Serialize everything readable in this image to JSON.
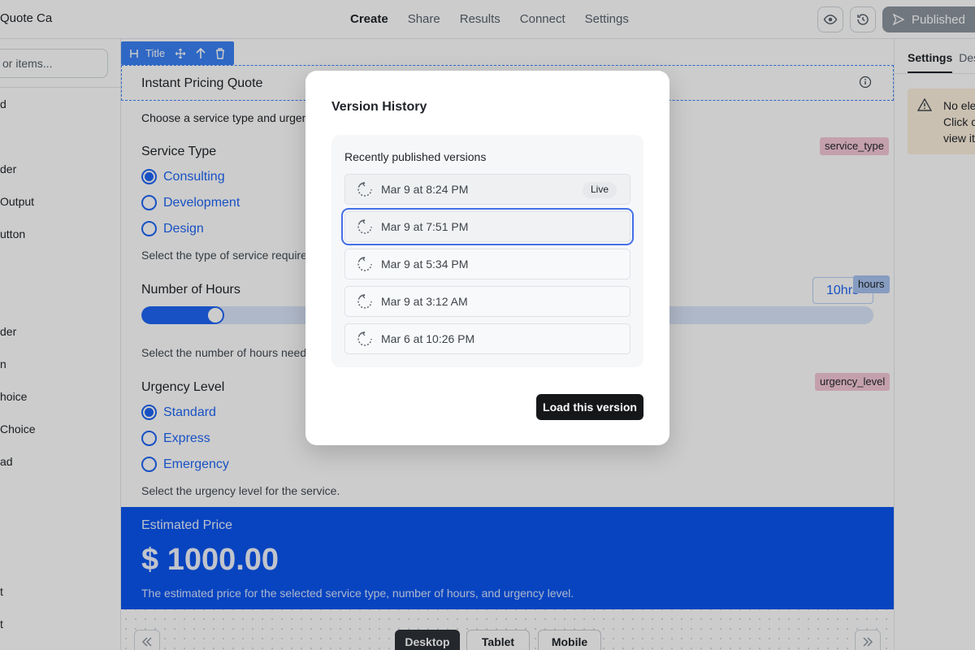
{
  "app": {
    "name": "Quote Ca"
  },
  "nav": {
    "tabs": [
      {
        "label": "Create",
        "active": true
      },
      {
        "label": "Share"
      },
      {
        "label": "Results"
      },
      {
        "label": "Connect"
      },
      {
        "label": "Settings"
      }
    ]
  },
  "toolbar": {
    "publish_label": "Published",
    "preview_icon": "eye-icon",
    "history_icon": "history-icon"
  },
  "sidebar": {
    "search_placeholder": "or items...",
    "items": [
      {
        "label": "d"
      },
      {
        "label": "der"
      },
      {
        "label": "Output"
      },
      {
        "label": "utton"
      },
      {
        "label": "der"
      },
      {
        "label": "n"
      },
      {
        "label": "hoice"
      },
      {
        "label": "Choice"
      },
      {
        "label": "ad"
      },
      {
        "label": "t"
      },
      {
        "label": "t"
      }
    ]
  },
  "form": {
    "toolbar_label": "Title",
    "title": "Instant Pricing Quote",
    "description": "Choose a service type and urgency",
    "service_type": {
      "label": "Service Type",
      "tag": "service_type",
      "options": [
        "Consulting",
        "Development",
        "Design"
      ],
      "selected": "Consulting",
      "help": "Select the type of service required"
    },
    "hours": {
      "label": "Number of Hours",
      "tag": "hours",
      "value_display": "10hrs",
      "slider_fraction": 0.1,
      "help": "Select the number of hours needed"
    },
    "urgency": {
      "label": "Urgency Level",
      "tag": "urgency_level",
      "options": [
        "Standard",
        "Express",
        "Emergency"
      ],
      "selected": "Standard",
      "help": "Select the urgency level for the service."
    },
    "price": {
      "label": "Estimated Price",
      "value": "$ 1000.00",
      "note": "The estimated price for the selected service type, number of hours, and urgency level."
    }
  },
  "devices": {
    "buttons": [
      "Desktop",
      "Tablet",
      "Mobile"
    ],
    "active": "Desktop"
  },
  "right_panel": {
    "tabs": [
      "Settings",
      "Des"
    ],
    "warning_lines": [
      "No ele",
      "Click c",
      "view it"
    ]
  },
  "modal": {
    "title": "Version History",
    "list_heading": "Recently published versions",
    "versions": [
      {
        "label": "Mar 9 at 8:24 PM",
        "badge": "Live"
      },
      {
        "label": "Mar 9 at 7:51 PM",
        "selected": true
      },
      {
        "label": "Mar 9 at 5:34 PM"
      },
      {
        "label": "Mar 9 at 3:12 AM"
      },
      {
        "label": "Mar 6 at 10:26 PM"
      }
    ],
    "load_label": "Load this version"
  },
  "colors": {
    "accent": "#1e66f5",
    "price_panel": "#0a56f0",
    "selection_outline": "#4470e8",
    "tag_pink": "#f6c9d7",
    "tag_blue": "#a8c4f0"
  }
}
